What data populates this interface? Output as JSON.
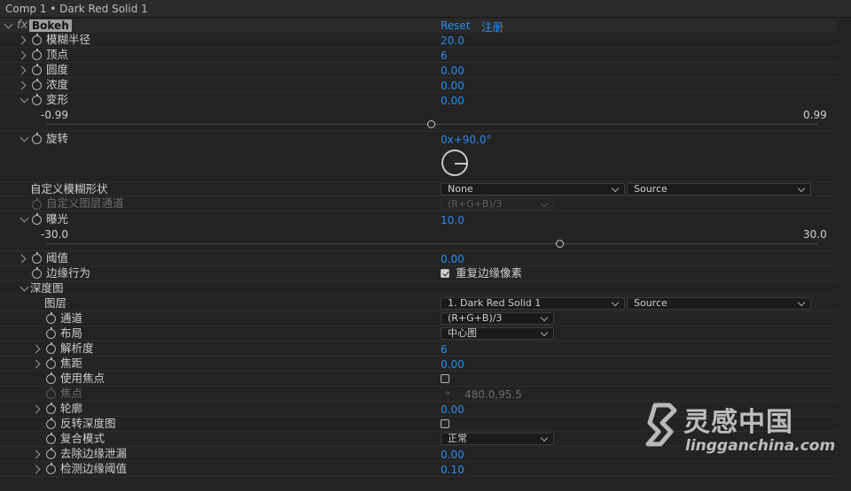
{
  "title": "Comp 1 • Dark Red Solid 1",
  "effect": {
    "fx": "fx",
    "name": "Bokeh",
    "reset": "Reset",
    "register": "注册"
  },
  "rows": {
    "blur_radius": {
      "label": "模糊半径",
      "value": "20.0"
    },
    "vertices": {
      "label": "顶点",
      "value": "6"
    },
    "roundness": {
      "label": "圆度",
      "value": "0.00"
    },
    "density": {
      "label": "浓度",
      "value": "0.00"
    },
    "deform": {
      "label": "变形",
      "value": "0.00",
      "min": "-0.99",
      "max": "0.99",
      "fraction": 0.5
    },
    "rotation": {
      "label": "旋转",
      "value": "0x+90.0°"
    },
    "custom_shape": {
      "label": "自定义模糊形状",
      "layer": "None",
      "source": "Source"
    },
    "custom_channel": {
      "label": "自定义图层通道",
      "value": "(R+G+B)/3"
    },
    "exposure": {
      "label": "曝光",
      "value": "10.0",
      "min": "-30.0",
      "max": "30.0",
      "fraction": 0.667
    },
    "threshold": {
      "label": "阈值",
      "value": "0.00"
    },
    "edge_behavior": {
      "label": "边缘行为",
      "checkbox_label": "重复边缘像素",
      "checked": true
    },
    "depth_map": {
      "label": "深度图"
    },
    "layer": {
      "label": "图层",
      "value": "1. Dark Red Solid 1",
      "source": "Source"
    },
    "channel": {
      "label": "通道",
      "value": "(R+G+B)/3"
    },
    "layout": {
      "label": "布局",
      "value": "中心图"
    },
    "resolution": {
      "label": "解析度",
      "value": "6"
    },
    "focal_distance": {
      "label": "焦距",
      "value": "0.00"
    },
    "use_focus": {
      "label": "使用焦点",
      "checked": false
    },
    "focus_point": {
      "label": "焦点",
      "value": "480.0,95.5"
    },
    "contour": {
      "label": "轮廓",
      "value": "0.00"
    },
    "invert_depth": {
      "label": "反转深度图",
      "checked": false
    },
    "blend_mode": {
      "label": "复合模式",
      "value": "正常"
    },
    "remove_edge_leak": {
      "label": "去除边缘泄漏",
      "value": "0.00"
    },
    "edge_detect_threshold": {
      "label": "检测边缘阈值",
      "value": "0.10"
    }
  },
  "watermark": {
    "brand": "灵感中国",
    "url": "lingganchina.com"
  },
  "colors": {
    "value_blue": "#2d8ceb",
    "panel_bg": "#232323"
  }
}
